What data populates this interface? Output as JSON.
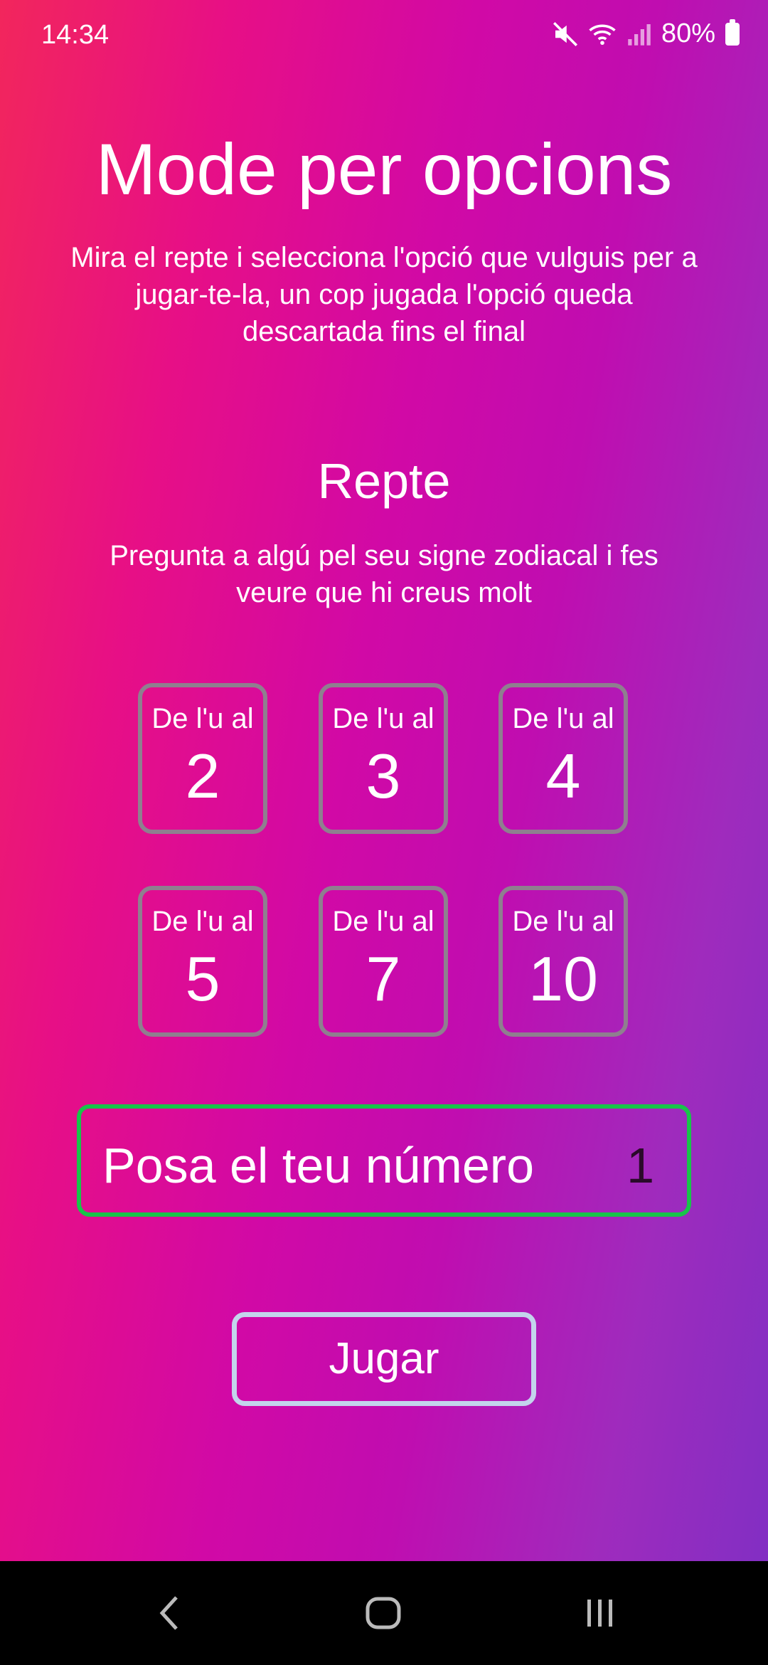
{
  "status_bar": {
    "time": "14:34",
    "battery": "80%",
    "icons": [
      "mute-icon",
      "wifi-icon",
      "signal-icon",
      "battery-icon"
    ]
  },
  "title": "Mode per opcions",
  "instructions": "Mira el repte i selecciona l'opció que vulguis per a jugar-te-la, un cop jugada l'opció queda descartada fins el final",
  "challenge": {
    "heading": "Repte",
    "text": "Pregunta a algú pel seu signe zodiacal i fes veure que hi creus molt"
  },
  "options": [
    {
      "caption": "De l'u al",
      "number": "2"
    },
    {
      "caption": "De l'u al",
      "number": "3"
    },
    {
      "caption": "De l'u al",
      "number": "4"
    },
    {
      "caption": "De l'u al",
      "number": "5"
    },
    {
      "caption": "De l'u al",
      "number": "7"
    },
    {
      "caption": "De l'u al",
      "number": "10"
    }
  ],
  "number_input": {
    "label": "Posa el teu número",
    "value": "1"
  },
  "play_button": "Jugar",
  "nav_bar": {
    "icons": [
      "back-icon",
      "home-icon",
      "recents-icon"
    ]
  },
  "colors": {
    "gradient_start": "#f2265c",
    "gradient_mid": "#c00db0",
    "gradient_end": "#7f2fc4",
    "option_border": "#8f7f8f",
    "input_border": "#18c44a",
    "button_border": "#c3d4ec"
  }
}
